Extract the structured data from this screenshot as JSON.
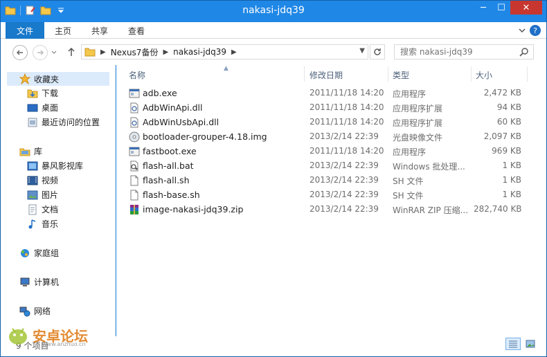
{
  "window": {
    "title": "nakasi-jdq39",
    "minimize": "─",
    "maximize": "☐",
    "close": "✕"
  },
  "ribbon": {
    "file_tab": "文件",
    "tabs": [
      "主页",
      "共享",
      "查看"
    ],
    "help": "?"
  },
  "address": {
    "crumbs": [
      "Nexus7备份",
      "nakasi-jdq39"
    ],
    "search_placeholder": "搜索 nakasi-jdq39"
  },
  "nav": {
    "favorites": "收藏夹",
    "fav_items": [
      "下载",
      "桌面",
      "最近访问的位置"
    ],
    "libraries": "库",
    "lib_items": [
      "暴风影视库",
      "视频",
      "图片",
      "文档",
      "音乐"
    ],
    "homegroup": "家庭组",
    "computer": "计算机",
    "network": "网络"
  },
  "columns": {
    "name": "名称",
    "date": "修改日期",
    "type": "类型",
    "size": "大小"
  },
  "files": [
    {
      "name": "adb.exe",
      "date": "2011/11/18 14:20",
      "type": "应用程序",
      "size": "2,472 KB",
      "icon": "exe-icon"
    },
    {
      "name": "AdbWinApi.dll",
      "date": "2011/11/18 14:20",
      "type": "应用程序扩展",
      "size": "94 KB",
      "icon": "dll-icon"
    },
    {
      "name": "AdbWinUsbApi.dll",
      "date": "2011/11/18 14:20",
      "type": "应用程序扩展",
      "size": "60 KB",
      "icon": "dll-icon"
    },
    {
      "name": "bootloader-grouper-4.18.img",
      "date": "2013/2/14 22:39",
      "type": "光盘映像文件",
      "size": "2,097 KB",
      "icon": "disc-image-icon"
    },
    {
      "name": "fastboot.exe",
      "date": "2011/11/18 14:20",
      "type": "应用程序",
      "size": "969 KB",
      "icon": "exe-icon"
    },
    {
      "name": "flash-all.bat",
      "date": "2013/2/14 22:39",
      "type": "Windows 批处理...",
      "size": "1 KB",
      "icon": "batch-icon"
    },
    {
      "name": "flash-all.sh",
      "date": "2013/2/14 22:39",
      "type": "SH 文件",
      "size": "1 KB",
      "icon": "file-icon"
    },
    {
      "name": "flash-base.sh",
      "date": "2013/2/14 22:39",
      "type": "SH 文件",
      "size": "1 KB",
      "icon": "file-icon"
    },
    {
      "name": "image-nakasi-jdq39.zip",
      "date": "2013/2/14 22:39",
      "type": "WinRAR ZIP 压缩...",
      "size": "282,740 KB",
      "icon": "winrar-icon"
    }
  ],
  "status": {
    "item_count": "9 个项目"
  },
  "watermark": {
    "text": "安卓论坛",
    "url": "www.anzhuo.cn"
  },
  "colors": {
    "titlebar": "#1f87e6",
    "file_tab": "#1979ca",
    "close": "#c7372f",
    "selected_nav": "#dcebfc"
  }
}
